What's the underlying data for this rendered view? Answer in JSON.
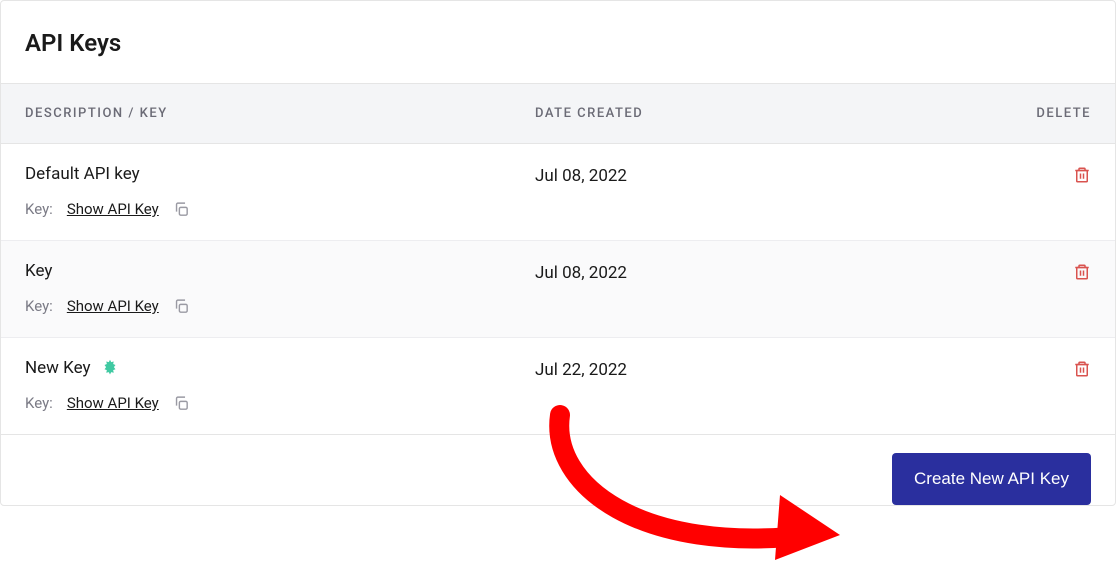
{
  "title": "API Keys",
  "columns": {
    "description": "DESCRIPTION / KEY",
    "date": "DATE CREATED",
    "delete": "DELETE"
  },
  "keyLabel": "Key:",
  "showLabel": "Show API Key",
  "rows": [
    {
      "name": "Default API key",
      "date": "Jul 08, 2022",
      "badge": false
    },
    {
      "name": "Key",
      "date": "Jul 08, 2022",
      "badge": false
    },
    {
      "name": "New Key",
      "date": "Jul 22, 2022",
      "badge": true
    }
  ],
  "createButton": "Create New API Key",
  "colors": {
    "primary": "#2a2f9e",
    "danger": "#d9534f",
    "badge": "#40c9a2"
  }
}
